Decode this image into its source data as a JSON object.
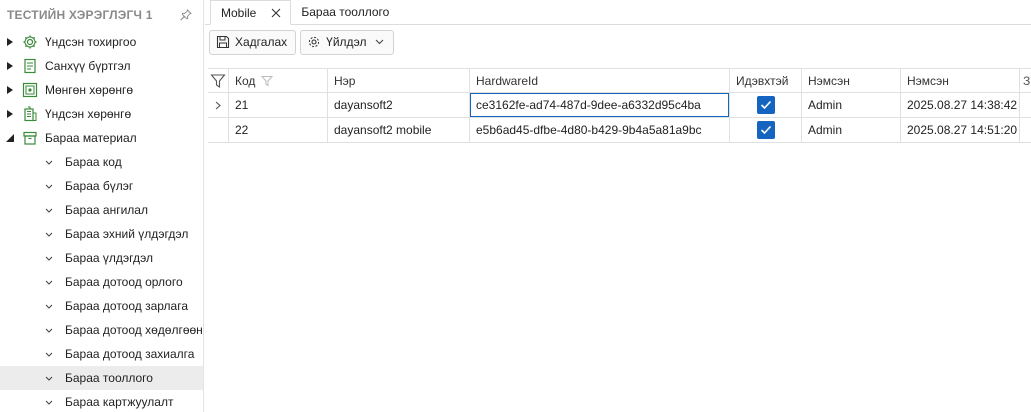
{
  "sidebar": {
    "title": "ТЕСТИЙН ХЭРЭГЛЭГЧ 1",
    "top_items": [
      {
        "label": "Үндсэн тохиргоо",
        "icon": "gear-icon"
      },
      {
        "label": "Санхүү бүртгэл",
        "icon": "ledger-icon"
      },
      {
        "label": "Мөнгөн хөрөнгө",
        "icon": "money-icon"
      },
      {
        "label": "Үндсэн хөрөнгө",
        "icon": "building-icon"
      },
      {
        "label": "Бараа материал",
        "icon": "box-icon"
      }
    ],
    "sub_items": [
      "Бараа код",
      "Бараа бүлэг",
      "Бараа ангилал",
      "Бараа эхний үлдэгдэл",
      "Бараа үлдэгдэл",
      "Бараа дотоод орлого",
      "Бараа дотоод зарлага",
      "Бараа дотоод хөдөлгөөн",
      "Бараа дотоод захиалга",
      "Бараа тооллого",
      "Бараа картжуулалт"
    ],
    "active_sub": "Бараа тооллого"
  },
  "tabs": [
    {
      "label": "Mobile",
      "active": true
    },
    {
      "label": "Бараа тооллого",
      "active": false
    }
  ],
  "toolbar": {
    "save_label": "Хадгалах",
    "actions_label": "Үйлдэл"
  },
  "grid": {
    "columns": [
      "Код",
      "Нэр",
      "HardwareId",
      "Идэвхтэй",
      "Нэмсэн",
      "Нэмсэн",
      "З"
    ],
    "rows": [
      {
        "code": "21",
        "name": "dayansoft2",
        "hardware_id": "ce3162fe-ad74-487d-9dee-a6332d95c4ba",
        "active": true,
        "added_by": "Admin",
        "added_at": "2025.08.27 14:38:42"
      },
      {
        "code": "22",
        "name": "dayansoft2 mobile",
        "hardware_id": "e5b6ad45-dfbe-4d80-b429-9b4a5a81a9bc",
        "active": true,
        "added_by": "Admin",
        "added_at": "2025.08.27 14:51:20"
      }
    ]
  },
  "colors": {
    "accent": "#1565c0",
    "icon_green": "#3a8a3a",
    "sidebar_title": "#8a8a8a"
  }
}
